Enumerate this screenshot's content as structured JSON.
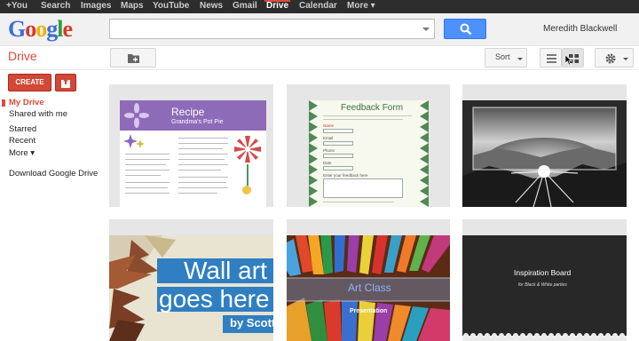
{
  "topbar": {
    "items": [
      {
        "label": "+You",
        "active": false
      },
      {
        "label": "Search",
        "active": false
      },
      {
        "label": "Images",
        "active": false
      },
      {
        "label": "Maps",
        "active": false
      },
      {
        "label": "YouTube",
        "active": false
      },
      {
        "label": "News",
        "active": false
      },
      {
        "label": "Gmail",
        "active": false
      },
      {
        "label": "Drive",
        "active": true
      },
      {
        "label": "Calendar",
        "active": false
      },
      {
        "label": "More ▾",
        "active": false
      }
    ]
  },
  "header": {
    "logo": [
      "G",
      "o",
      "o",
      "g",
      "l",
      "e"
    ],
    "logo_colors": [
      "#3a6fd8",
      "#d6392b",
      "#f0b400",
      "#3a6fd8",
      "#2f9d3f",
      "#d6392b"
    ],
    "search_value": "",
    "account_name": "Meredith Blackwell"
  },
  "toolbar": {
    "app_title": "Drive",
    "sort_label": "Sort",
    "sort_caret": "▾",
    "accent": "#dd4b39"
  },
  "sidebar": {
    "create_label": "CREATE",
    "items": [
      {
        "label": "My Drive"
      },
      {
        "label": "Shared with me"
      },
      {
        "label": "Starred"
      },
      {
        "label": "Recent"
      },
      {
        "label": "More ▾"
      },
      {
        "label": "Download Google Drive"
      }
    ]
  },
  "files": [
    {
      "title": "Recipe",
      "subtitle": "Grandma's Pot Pie"
    },
    {
      "title": "Feedback Form",
      "fields": [
        "Name",
        "Email",
        "Phone",
        "Date",
        "Enter your feedback here"
      ]
    },
    {
      "title": ""
    },
    {
      "title": "Wall art",
      "line2": "goes here",
      "line3": "by Scott"
    },
    {
      "title": "Art Class",
      "subtitle": "Presentation"
    },
    {
      "title": "Inspiration Board",
      "subtitle": "for Black & White parties"
    }
  ]
}
